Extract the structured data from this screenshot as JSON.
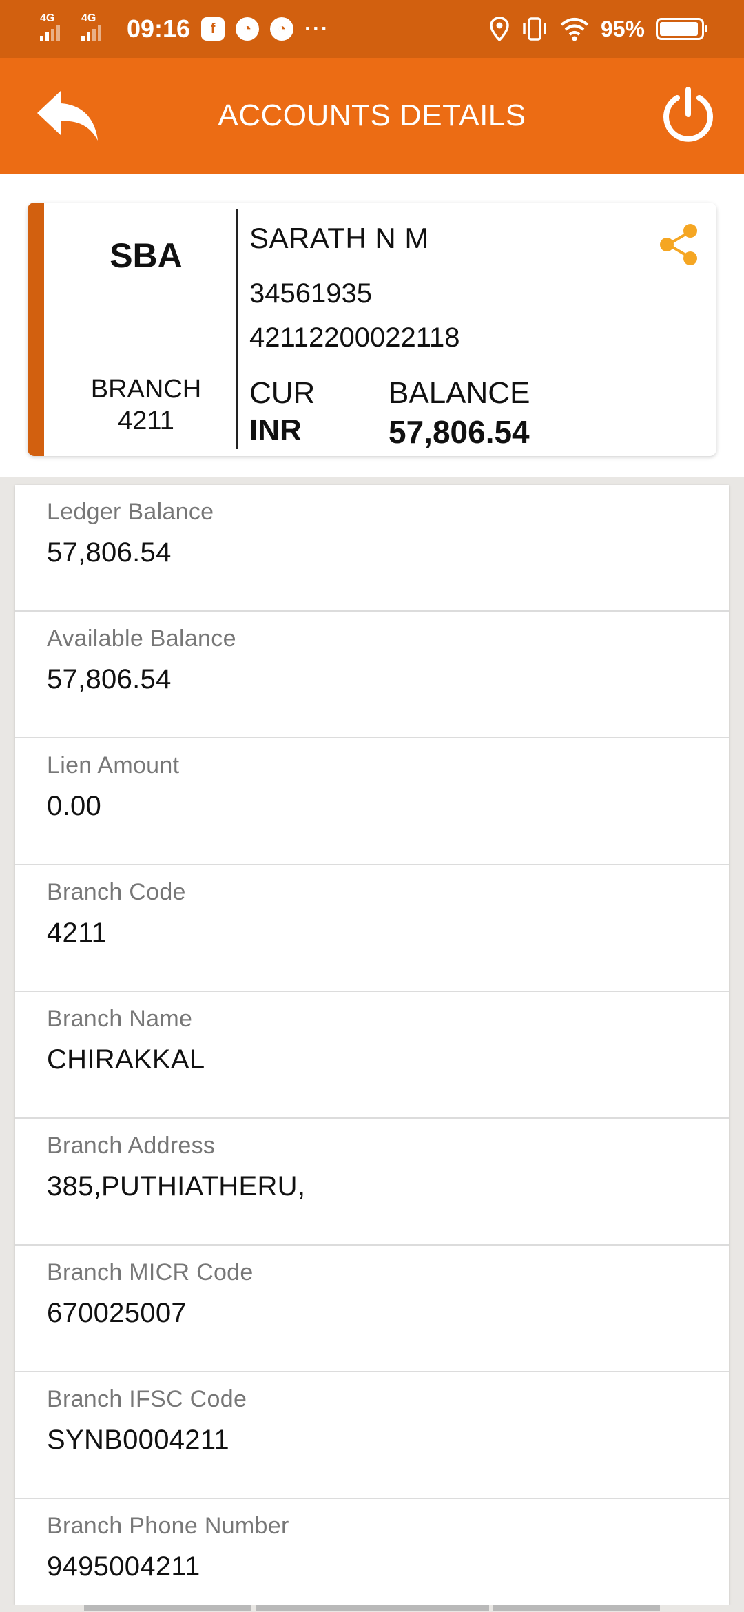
{
  "status_bar": {
    "network_1": "4G",
    "network_2": "4G",
    "time": "09:16",
    "battery": "95%",
    "overflow": "···"
  },
  "app_bar": {
    "title": "ACCOUNTS DETAILS"
  },
  "account_card": {
    "type": "SBA",
    "branch_label": "BRANCH",
    "branch_number": "4211",
    "holder_name": "SARATH N M",
    "customer_id": "34561935",
    "account_number": "42112200022118",
    "currency_label": "CUR",
    "currency_value": "INR",
    "balance_label": "BALANCE",
    "balance_value": "57,806.54",
    "accent_color": "#d2600f",
    "share_icon_color": "#f5a623"
  },
  "details": [
    {
      "label": "Ledger Balance",
      "value": "57,806.54"
    },
    {
      "label": "Available Balance",
      "value": "57,806.54"
    },
    {
      "label": "Lien Amount",
      "value": "0.00"
    },
    {
      "label": "Branch Code",
      "value": "4211"
    },
    {
      "label": "Branch Name",
      "value": "CHIRAKKAL"
    },
    {
      "label": "Branch Address",
      "value": "385,PUTHIATHERU,"
    },
    {
      "label": "Branch MICR Code",
      "value": "670025007"
    },
    {
      "label": "Branch IFSC Code",
      "value": "SYNB0004211"
    },
    {
      "label": "Branch Phone Number",
      "value": "9495004211"
    }
  ],
  "theme": {
    "status_bar_color": "#d2600f",
    "app_bar_color": "#ec6c14"
  }
}
